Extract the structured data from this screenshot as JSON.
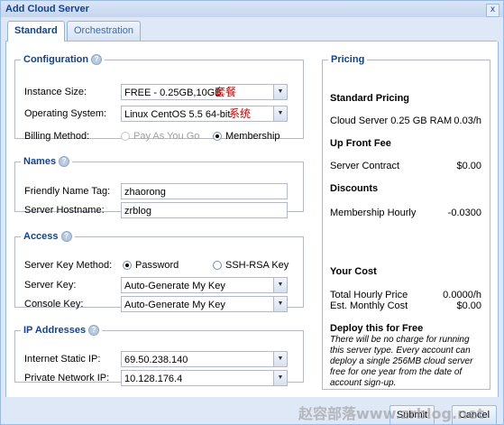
{
  "window": {
    "title": "Add Cloud Server",
    "close_glyph": "x"
  },
  "tabs": [
    {
      "label": "Standard",
      "active": true
    },
    {
      "label": "Orchestration",
      "active": false
    }
  ],
  "configuration": {
    "legend": "Configuration",
    "instance_size_label": "Instance Size:",
    "instance_size_value": "FREE - 0.25GB,10GB",
    "instance_size_annotation": "套餐",
    "os_label": "Operating System:",
    "os_value": "Linux CentOS 5.5 64-bit",
    "os_annotation": "系统",
    "billing_label": "Billing Method:",
    "billing_options": [
      {
        "label": "Pay As You Go",
        "selected": false,
        "disabled": true
      },
      {
        "label": "Membership",
        "selected": true,
        "disabled": false
      }
    ]
  },
  "names": {
    "legend": "Names",
    "friendly_label": "Friendly Name Tag:",
    "friendly_value": "zhaorong",
    "hostname_label": "Server Hostname:",
    "hostname_value": "zrblog"
  },
  "access": {
    "legend": "Access",
    "key_method_label": "Server Key Method:",
    "key_method_options": [
      {
        "label": "Password",
        "selected": true
      },
      {
        "label": "SSH-RSA Key",
        "selected": false
      }
    ],
    "server_key_label": "Server Key:",
    "server_key_value": "Auto-Generate My Key",
    "console_key_label": "Console Key:",
    "console_key_value": "Auto-Generate My Key"
  },
  "ip": {
    "legend": "IP Addresses",
    "static_label": "Internet Static IP:",
    "static_value": "69.50.238.140",
    "private_label": "Private Network IP:",
    "private_value": "10.128.176.4"
  },
  "pricing": {
    "legend": "Pricing",
    "standard_heading": "Standard Pricing",
    "cloud_server_label": "Cloud Server 0.25 GB RAM",
    "cloud_server_value": "0.03/h",
    "upfront_heading": "Up Front Fee",
    "contract_label": "Server Contract",
    "contract_value": "$0.00",
    "discounts_heading": "Discounts",
    "membership_label": "Membership Hourly",
    "membership_value": "-0.0300",
    "your_cost_heading": "Your Cost",
    "hourly_label": "Total Hourly Price",
    "hourly_value": "0.0000/h",
    "monthly_label": "Est. Monthly Cost",
    "monthly_value": "$0.00",
    "deploy_heading": "Deploy this for Free",
    "deploy_note": "There will be no charge for running this server type. Every account can deploy a single 256MB cloud server free for one year from the date of account sign-up."
  },
  "footer": {
    "submit_label": "Submit",
    "cancel_label": "Cancel"
  },
  "watermark": "赵容部落www.zrblog.net",
  "help_glyph": "?",
  "dropdown_glyph": "▼"
}
